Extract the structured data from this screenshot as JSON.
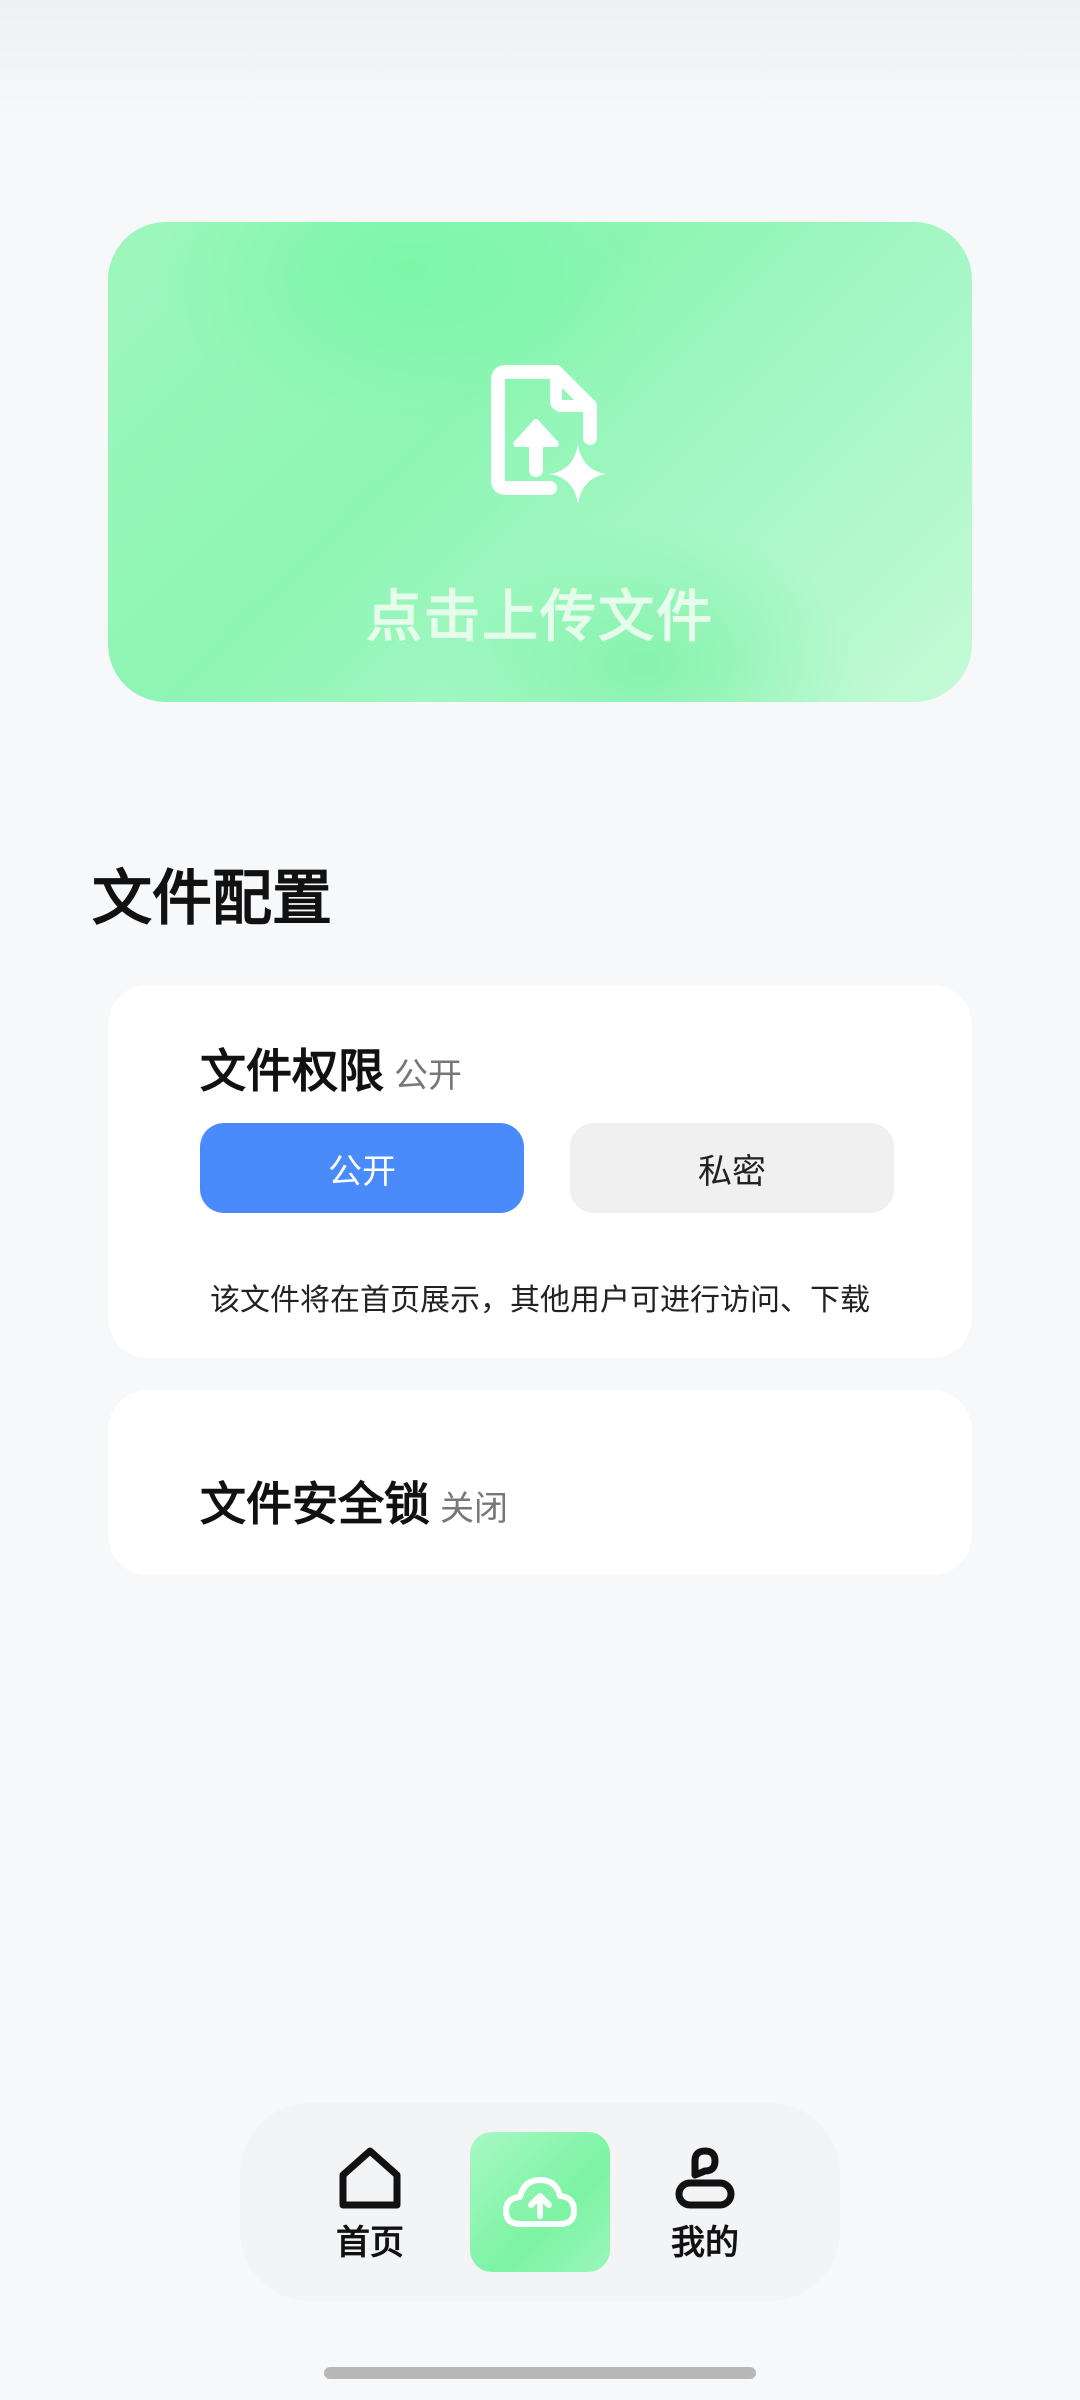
{
  "upload": {
    "label": "点击上传文件",
    "icon": "file-upload-sparkle-icon"
  },
  "config": {
    "section_title": "文件配置",
    "permission": {
      "title": "文件权限",
      "status": "公开",
      "options": [
        "公开",
        "私密"
      ],
      "selected": "公开",
      "description": "该文件将在首页展示，其他用户可进行访问、下载"
    },
    "lock": {
      "title": "文件安全锁",
      "status": "关闭"
    }
  },
  "tabbar": {
    "home_label": "首页",
    "me_label": "我的",
    "upload_icon": "cloud-upload-icon"
  },
  "colors": {
    "accent_blue": "#4A8BFB",
    "accent_green": "#7CF3A3",
    "background": "#F7F8FA"
  }
}
